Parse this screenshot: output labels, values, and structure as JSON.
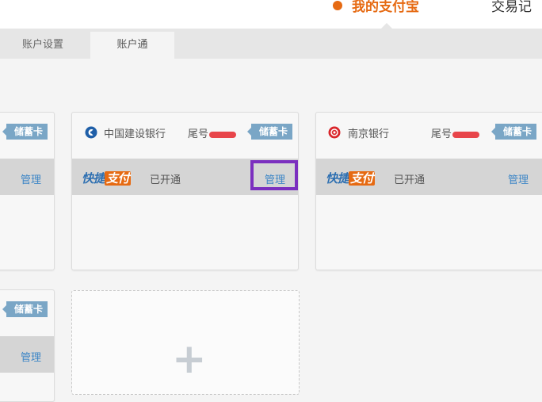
{
  "topnav": {
    "active_label": "我的支付宝",
    "next_label": "交易记"
  },
  "subnav": {
    "tabs": [
      {
        "label": "账户设置"
      },
      {
        "label": "账户通"
      }
    ]
  },
  "cards": {
    "left_top": {
      "tag": "储蓄卡",
      "manage": "管理"
    },
    "ccb": {
      "bank": "中国建设银行",
      "tail_label": "尾号",
      "tag": "储蓄卡",
      "quickpay_a": "快捷",
      "quickpay_b": "支付",
      "status": "已开通",
      "manage": "管理"
    },
    "nanjing": {
      "bank": "南京银行",
      "tail_label": "尾号",
      "tag": "储蓄卡",
      "quickpay_a": "快捷",
      "quickpay_b": "支付",
      "status": "已开通",
      "manage": "管理"
    },
    "left_bottom": {
      "tag": "储蓄卡",
      "manage": "管理"
    },
    "add": {
      "symbol": "+"
    }
  },
  "colors": {
    "accent_orange": "#e66a12",
    "link_blue": "#3d86c6",
    "tag_blue": "#7aa6c6",
    "highlight_purple": "#7b2fbf",
    "ccb_blue": "#1f5fa8",
    "nanjing_red": "#d9262b"
  }
}
